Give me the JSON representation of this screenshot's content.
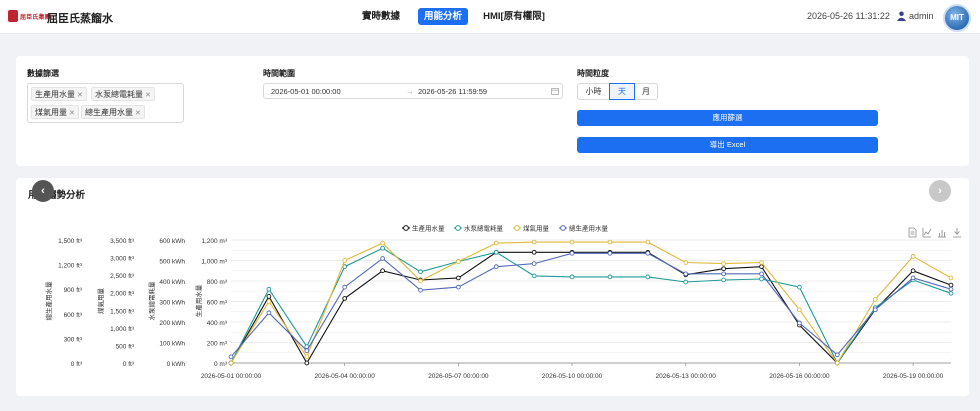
{
  "header": {
    "logo_text": "屈臣氏集團",
    "brand": "屈臣氏蒸餾水",
    "nav": [
      {
        "label": "實時數據",
        "active": false
      },
      {
        "label": "用能分析",
        "active": true
      },
      {
        "label": "HMI[原有權限]",
        "active": false
      }
    ],
    "datetime": "2026-05-26 11:31:22",
    "username": "admin",
    "badge_text": "MIT"
  },
  "filters": {
    "data_filter_label": "數據篩選",
    "tags": [
      "生產用水量",
      "水泵總電耗量",
      "煤氣用量",
      "總生產用水量"
    ],
    "time_range_label": "時間範圍",
    "start": "2026-05-01 00:00:00",
    "arrow": "→",
    "end": "2026-05-26 11:59:59",
    "granularity_label": "時間粒度",
    "granularity": [
      {
        "label": "小時",
        "active": false
      },
      {
        "label": "天",
        "active": true
      },
      {
        "label": "月",
        "active": false
      }
    ],
    "apply_label": "應用篩選",
    "export_label": "導出 Excel"
  },
  "chart_card": {
    "title": "用能趨勢分析"
  },
  "chart_data": {
    "type": "line",
    "x": [
      "2026-05-01",
      "2026-05-02",
      "2026-05-03",
      "2026-05-04",
      "2026-05-05",
      "2026-05-06",
      "2026-05-07",
      "2026-05-08",
      "2026-05-09",
      "2026-05-10",
      "2026-05-11",
      "2026-05-12",
      "2026-05-13",
      "2026-05-14",
      "2026-05-15",
      "2026-05-16",
      "2026-05-17",
      "2026-05-18",
      "2026-05-19",
      "2026-05-20"
    ],
    "x_tick_labels": [
      "2026-05-01 00:00:00",
      "2026-05-04 00:00:00",
      "2026-05-07 00:00:00",
      "2026-05-10 00:00:00",
      "2026-05-13 00:00:00",
      "2026-05-16 00:00:00",
      "2026-05-19 00:00:00"
    ],
    "series": [
      {
        "name": "生產用水量",
        "color": "#111111",
        "axis": "生產用水量",
        "values": [
          0,
          650,
          0,
          630,
          900,
          810,
          830,
          1080,
          1080,
          1080,
          1080,
          1080,
          860,
          920,
          940,
          370,
          0,
          520,
          900,
          760
        ]
      },
      {
        "name": "水泵總電耗量",
        "color": "#1f9a98",
        "axis": "水泵總電耗量",
        "values": [
          0,
          720,
          160,
          940,
          1120,
          890,
          990,
          1080,
          850,
          840,
          840,
          840,
          790,
          810,
          820,
          740,
          0,
          540,
          810,
          680
        ]
      },
      {
        "name": "煤氣用量",
        "color": "#e0b83a",
        "axis": "煤氣用量",
        "values": [
          0,
          600,
          60,
          1000,
          1170,
          800,
          990,
          1170,
          1180,
          1180,
          1180,
          1180,
          980,
          970,
          980,
          520,
          0,
          620,
          1040,
          830
        ]
      },
      {
        "name": "總生產用水量",
        "color": "#5468b8",
        "axis": "總生產用水量",
        "values": [
          60,
          490,
          120,
          740,
          1020,
          710,
          740,
          940,
          970,
          1070,
          1070,
          1070,
          870,
          870,
          870,
          390,
          80,
          520,
          830,
          720
        ]
      }
    ],
    "axes": [
      {
        "name": "總生產用水量",
        "ticks": [
          "0 ft³",
          "300 ft³",
          "600 ft³",
          "900 ft³",
          "1,200 ft³",
          "1,500 ft³"
        ]
      },
      {
        "name": "煤氣用量",
        "ticks": [
          "0 ft³",
          "500 ft³",
          "1,000 ft³",
          "1,500 ft³",
          "2,000 ft³",
          "2,500 ft³",
          "3,000 ft³",
          "3,500 ft³"
        ]
      },
      {
        "name": "水泵總電耗量",
        "ticks": [
          "0 kWh",
          "100 kWh",
          "200 kWh",
          "300 kWh",
          "400 kWh",
          "500 kWh",
          "600 kWh"
        ]
      },
      {
        "name": "生產用水量",
        "ticks": [
          "0 m³",
          "200 m³",
          "400 m³",
          "600 m³",
          "800 m³",
          "1,000 m³",
          "1,200 m³"
        ]
      }
    ],
    "ylim": [
      0,
      1200
    ],
    "legend_position": "top-center",
    "grid": true
  }
}
